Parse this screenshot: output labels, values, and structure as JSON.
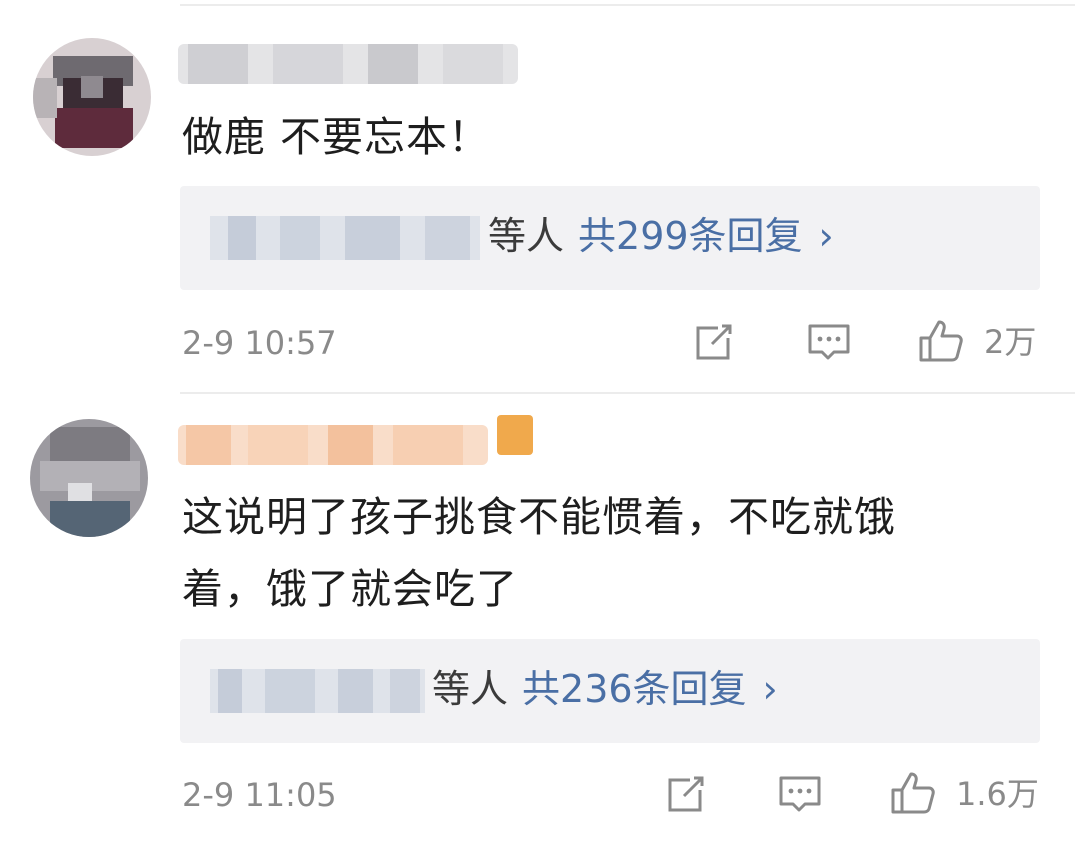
{
  "comments": [
    {
      "username": "",
      "text_lines": [
        "做鹿 不要忘本！"
      ],
      "reply_suffix": "等人",
      "reply_count": "共299条回复",
      "time": "2-9 10:57",
      "likes": "2万"
    },
    {
      "username": "",
      "text_lines": [
        "这说明了孩子挑食不能惯着，不吃就饿",
        "着，饿了就会吃了"
      ],
      "reply_suffix": "等人",
      "reply_count": "共236条回复",
      "time": "2-9 11:05",
      "likes": "1.6万"
    }
  ],
  "icons": {
    "share": "share-icon",
    "comment": "comment-icon",
    "like": "thumbs-up-icon",
    "chevron": "chevron-right-icon"
  },
  "chevron_glyph": "›",
  "colors": {
    "link": "#4a6fa5",
    "meta": "#8a8a8a",
    "reply_bg": "#f2f2f4"
  }
}
